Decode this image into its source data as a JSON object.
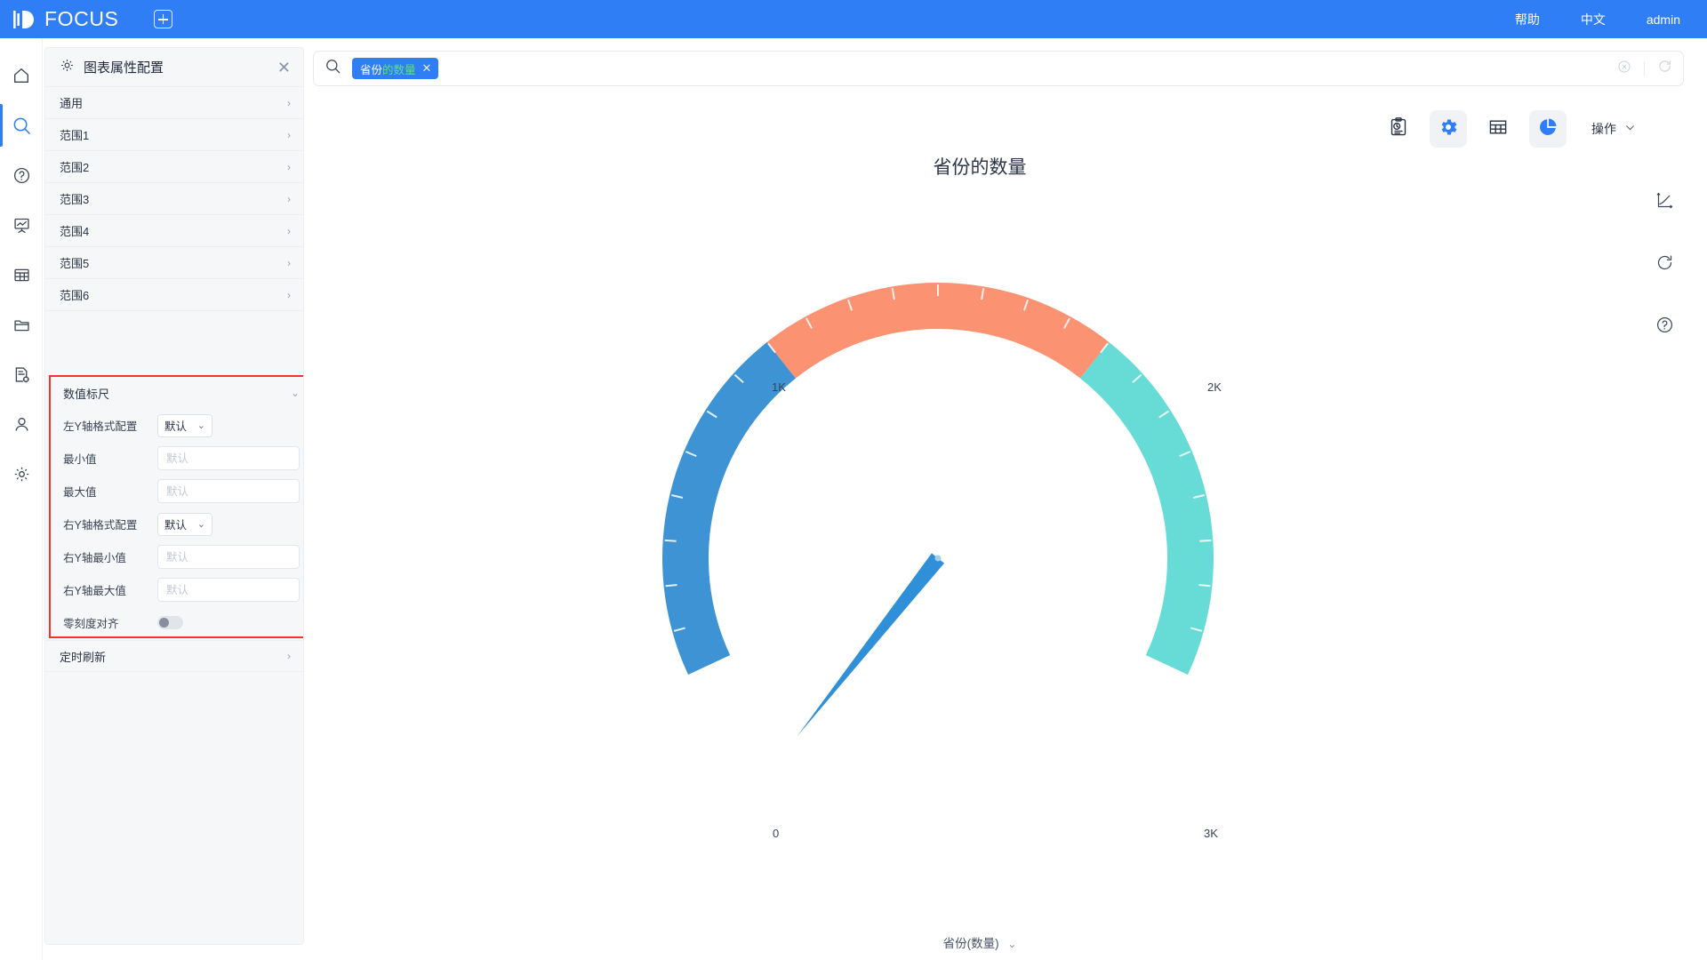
{
  "header": {
    "brand": "FOCUS",
    "new_tab_icon": "plus-icon",
    "help": "帮助",
    "language": "中文",
    "user": "admin"
  },
  "rail": {
    "items": [
      {
        "icon": "home-icon",
        "active": false
      },
      {
        "icon": "search-icon",
        "active": true
      },
      {
        "icon": "help-circle-icon",
        "active": false
      },
      {
        "icon": "presentation-chart-icon",
        "active": false
      },
      {
        "icon": "table-icon",
        "active": false
      },
      {
        "icon": "folder-icon",
        "active": false
      },
      {
        "icon": "document-settings-icon",
        "active": false
      },
      {
        "icon": "user-icon",
        "active": false
      },
      {
        "icon": "settings-gear-icon",
        "active": false
      }
    ]
  },
  "panel": {
    "title": "图表属性配置",
    "gear_icon": "gear-icon",
    "close_icon": "close-icon",
    "sections": [
      {
        "label": "通用"
      },
      {
        "label": "范围1"
      },
      {
        "label": "范围2"
      },
      {
        "label": "范围3"
      },
      {
        "label": "范围4"
      },
      {
        "label": "范围5"
      },
      {
        "label": "范围6"
      }
    ],
    "footer_section": {
      "label": "定时刷新"
    },
    "scale_section": {
      "title": "数值标尺",
      "highlight_color": "#f5342a",
      "fields": [
        {
          "label": "左Y轴格式配置",
          "type": "select",
          "value": "默认"
        },
        {
          "label": "最小值",
          "type": "input",
          "value": "",
          "placeholder": "默认"
        },
        {
          "label": "最大值",
          "type": "input",
          "value": "",
          "placeholder": "默认"
        },
        {
          "label": "右Y轴格式配置",
          "type": "select",
          "value": "默认"
        },
        {
          "label": "右Y轴最小值",
          "type": "input",
          "value": "",
          "placeholder": "默认"
        },
        {
          "label": "右Y轴最大值",
          "type": "input",
          "value": "",
          "placeholder": "默认"
        },
        {
          "label": "零刻度对齐",
          "type": "toggle",
          "value": "off"
        }
      ]
    }
  },
  "search": {
    "icon": "search-icon",
    "placeholder": "",
    "chip": {
      "prefix": "省份",
      "suffix": "的数量",
      "remove_icon": "close-icon"
    },
    "clear_icon": "clear-circle-icon",
    "refresh_icon": "refresh-icon"
  },
  "toolbar": {
    "items": [
      {
        "icon": "clipboard-history-icon",
        "active": false
      },
      {
        "icon": "gear-icon",
        "active": true
      },
      {
        "icon": "table-icon",
        "active": false
      },
      {
        "icon": "pie-chart-icon",
        "active": true
      }
    ],
    "action_label": "操作",
    "action_chevron": "chevron-down-icon"
  },
  "right_strip": {
    "items": [
      {
        "icon": "axis-trend-icon"
      },
      {
        "icon": "refresh-icon"
      },
      {
        "icon": "help-circle-icon"
      }
    ]
  },
  "chart_data": {
    "type": "gauge",
    "title": "省份的数量",
    "legend": "省份(数量)",
    "legend_chevron": "chevron-down-icon",
    "min": 0,
    "max": 3000,
    "value": 2000,
    "tick_labels": [
      "0",
      "1K",
      "2K",
      "3K"
    ],
    "tick_values": [
      0,
      1000,
      2000,
      3000
    ],
    "bands": [
      {
        "from": 0,
        "to": 1000,
        "color": "#3d93d4"
      },
      {
        "from": 1000,
        "to": 2000,
        "color": "#fb9272"
      },
      {
        "from": 2000,
        "to": 3000,
        "color": "#67dbd6"
      }
    ],
    "needle_color": "#2f8fd8",
    "start_angle": 205,
    "end_angle": -25
  }
}
